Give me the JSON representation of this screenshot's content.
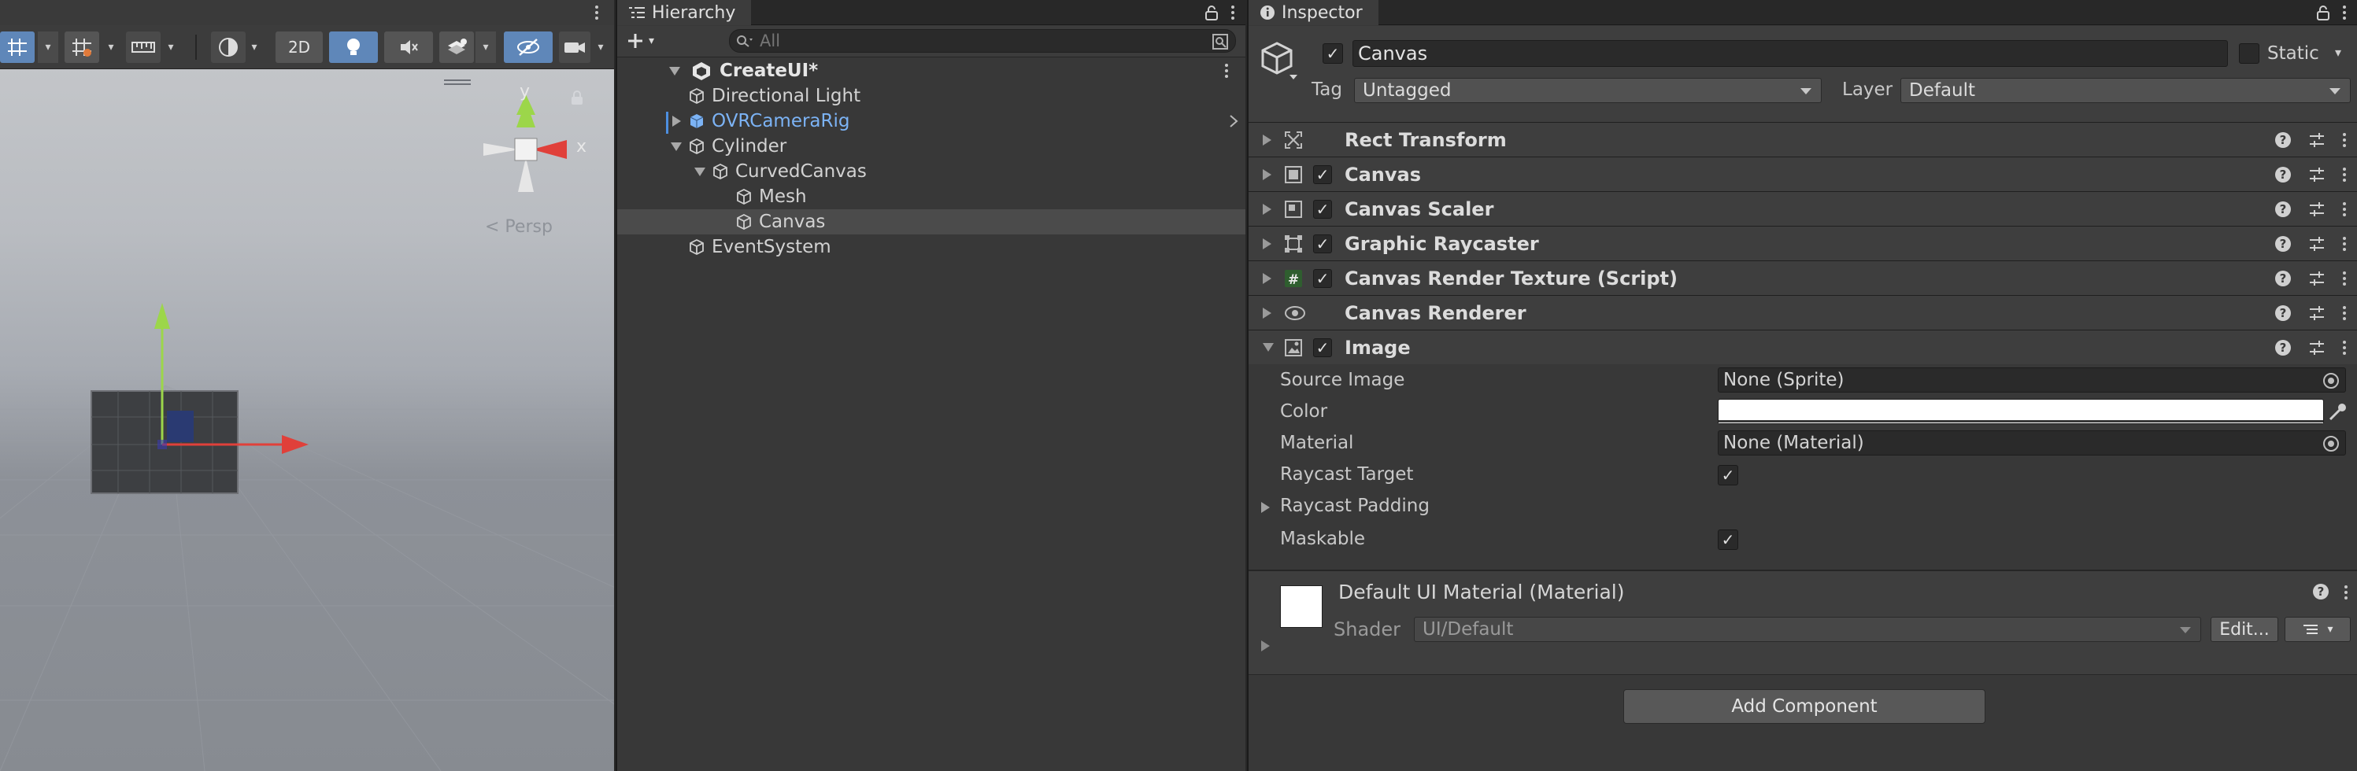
{
  "colors": {
    "panel_bg": "#383838",
    "header_bg": "#282828",
    "accent_blue": "#5f87b9",
    "prefab_blue": "#7cb3f5",
    "axis_x": "#e0403a",
    "axis_y": "#9cd64a",
    "axis_z": "#4a7ad8"
  },
  "scene": {
    "toolbar": {
      "mode_2d_label": "2D",
      "icons": [
        "grid-snap-icon",
        "grid-icon",
        "ruler-icon",
        "shading-icon",
        "lighting-icon",
        "audio-mute-icon",
        "effects-icon",
        "visibility-icon",
        "camera-icon"
      ]
    },
    "gizmo": {
      "y_label": "y",
      "x_label": "x",
      "persp_label": "< Persp"
    }
  },
  "hierarchy": {
    "tab_title": "Hierarchy",
    "search_placeholder": "All",
    "scene_name": "CreateUI*",
    "items": [
      {
        "label": "Directional Light",
        "depth": 1,
        "fold": "none",
        "prefab": false,
        "selected": false
      },
      {
        "label": "OVRCameraRig",
        "depth": 1,
        "fold": "collapsed",
        "prefab": true,
        "selected": false
      },
      {
        "label": "Cylinder",
        "depth": 1,
        "fold": "expanded",
        "prefab": false,
        "selected": false
      },
      {
        "label": "CurvedCanvas",
        "depth": 2,
        "fold": "expanded",
        "prefab": false,
        "selected": false
      },
      {
        "label": "Mesh",
        "depth": 3,
        "fold": "none",
        "prefab": false,
        "selected": false
      },
      {
        "label": "Canvas",
        "depth": 3,
        "fold": "none",
        "prefab": false,
        "selected": true
      },
      {
        "label": "EventSystem",
        "depth": 1,
        "fold": "none",
        "prefab": false,
        "selected": false
      }
    ]
  },
  "inspector": {
    "tab_title": "Inspector",
    "object_name": "Canvas",
    "static_label": "Static",
    "tag_label": "Tag",
    "tag_value": "Untagged",
    "layer_label": "Layer",
    "layer_value": "Default",
    "components": [
      {
        "name": "Rect Transform",
        "has_toggle": false,
        "icon": "rect-transform-icon"
      },
      {
        "name": "Canvas",
        "has_toggle": true,
        "icon": "canvas-icon"
      },
      {
        "name": "Canvas Scaler",
        "has_toggle": true,
        "icon": "canvas-scaler-icon"
      },
      {
        "name": "Graphic Raycaster",
        "has_toggle": true,
        "icon": "graphic-raycaster-icon"
      },
      {
        "name": "Canvas Render Texture (Script)",
        "has_toggle": true,
        "icon": "script-icon"
      },
      {
        "name": "Canvas Renderer",
        "has_toggle": false,
        "icon": "eye-icon"
      },
      {
        "name": "Image",
        "has_toggle": true,
        "icon": "image-icon"
      }
    ],
    "image_props": {
      "source_image_label": "Source Image",
      "source_image_value": "None (Sprite)",
      "color_label": "Color",
      "material_label": "Material",
      "material_value": "None (Material)",
      "raycast_target_label": "Raycast Target",
      "raycast_padding_label": "Raycast Padding",
      "maskable_label": "Maskable"
    },
    "material": {
      "title": "Default UI Material (Material)",
      "shader_label": "Shader",
      "shader_value": "UI/Default",
      "edit_label": "Edit..."
    },
    "add_component_label": "Add Component"
  }
}
